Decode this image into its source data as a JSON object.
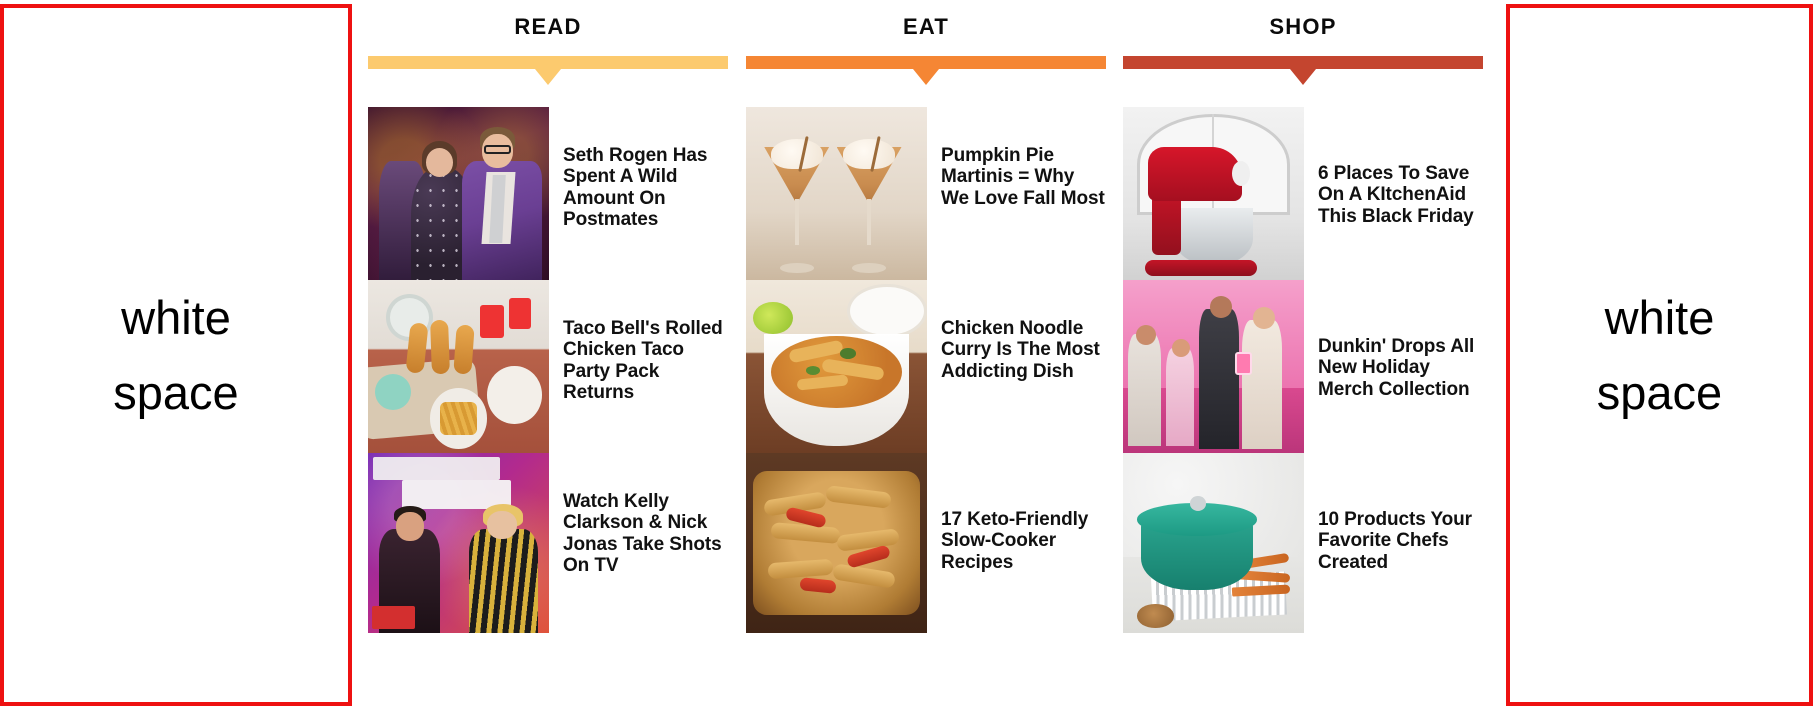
{
  "annotations": {
    "left_note": "white\nspace",
    "right_note": "white\nspace",
    "box_color": "#ee1111"
  },
  "columns": [
    {
      "title": "READ",
      "bar_color": "#fcca6e",
      "arrow_color": "#fcca6e",
      "articles": [
        {
          "headline": "Seth Rogen Has Spent A Wild Amount On Postmates",
          "thumb": "seth-rogen-red-carpet-photo"
        },
        {
          "headline": "Taco Bell's Rolled Chicken Taco Party Pack Returns",
          "thumb": "taco-bell-food-spread-photo"
        },
        {
          "headline": "Watch Kelly Clarkson & Nick Jonas Take Shots On TV",
          "thumb": "kelly-clarkson-show-photo"
        }
      ]
    },
    {
      "title": "EAT",
      "bar_color": "#f58634",
      "arrow_color": "#f58634",
      "articles": [
        {
          "headline": "Pumpkin Pie Martinis = Why We Love Fall Most",
          "thumb": "pumpkin-pie-martini-photo"
        },
        {
          "headline": "Chicken Noodle Curry Is The Most Addicting Dish",
          "thumb": "chicken-noodle-curry-bowl-photo"
        },
        {
          "headline": "17 Keto-Friendly Slow-Cooker Recipes",
          "thumb": "keto-slow-cooker-chicken-photo"
        }
      ]
    },
    {
      "title": "SHOP",
      "bar_color": "#c4452f",
      "arrow_color": "#c4452f",
      "articles": [
        {
          "headline": "6 Places To Save On A KItchenAid This Black Friday",
          "thumb": "red-kitchenaid-stand-mixer-photo"
        },
        {
          "headline": "Dunkin' Drops All New Holiday Merch Collection",
          "thumb": "dunkin-holiday-merch-photo"
        },
        {
          "headline": "10 Products Your Favorite Chefs Created",
          "thumb": "teal-dutch-oven-photo"
        }
      ]
    }
  ]
}
